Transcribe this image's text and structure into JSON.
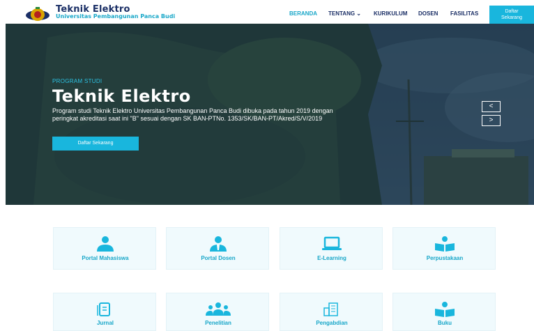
{
  "brand": {
    "title": "Teknik Elektro",
    "subtitle": "Universitas Pembangunan Panca Budi"
  },
  "nav": {
    "items": [
      {
        "label": "BERANDA",
        "active": true
      },
      {
        "label": "TENTANG ⌄",
        "active": false
      },
      {
        "label": "KURIKULUM",
        "active": false
      },
      {
        "label": "DOSEN",
        "active": false
      },
      {
        "label": "FASILITAS",
        "active": false
      }
    ],
    "cta": "Daftar Sekarang"
  },
  "hero": {
    "eyebrow": "PROGRAM STUDI",
    "title": "Teknik Elektro",
    "description": "Program studi Teknik Elektro Universitas Pembangunan Panca Budi dibuka pada tahun 2019 dengan peringkat akreditasi saat ini \"B\" sesuai dengan SK BAN-PTNo. 1353/SK/BAN-PT/Akred/S/V/2019",
    "button": "Daftar Sekarang",
    "prev": "<",
    "next": ">"
  },
  "services": [
    {
      "label": "Portal Mahasiswa",
      "icon": "student-icon"
    },
    {
      "label": "Portal Dosen",
      "icon": "lecturer-icon"
    },
    {
      "label": "E-Learning",
      "icon": "laptop-icon"
    },
    {
      "label": "Perpustakaan",
      "icon": "book-reader-icon"
    },
    {
      "label": "Jurnal",
      "icon": "journal-icon"
    },
    {
      "label": "Penelitian",
      "icon": "group-icon"
    },
    {
      "label": "Pengabdian",
      "icon": "building-icon"
    },
    {
      "label": "Buku",
      "icon": "book-reader-icon"
    }
  ],
  "colors": {
    "accent": "#19b6dd",
    "navy": "#1b2f66",
    "card": "#f0fafd"
  }
}
